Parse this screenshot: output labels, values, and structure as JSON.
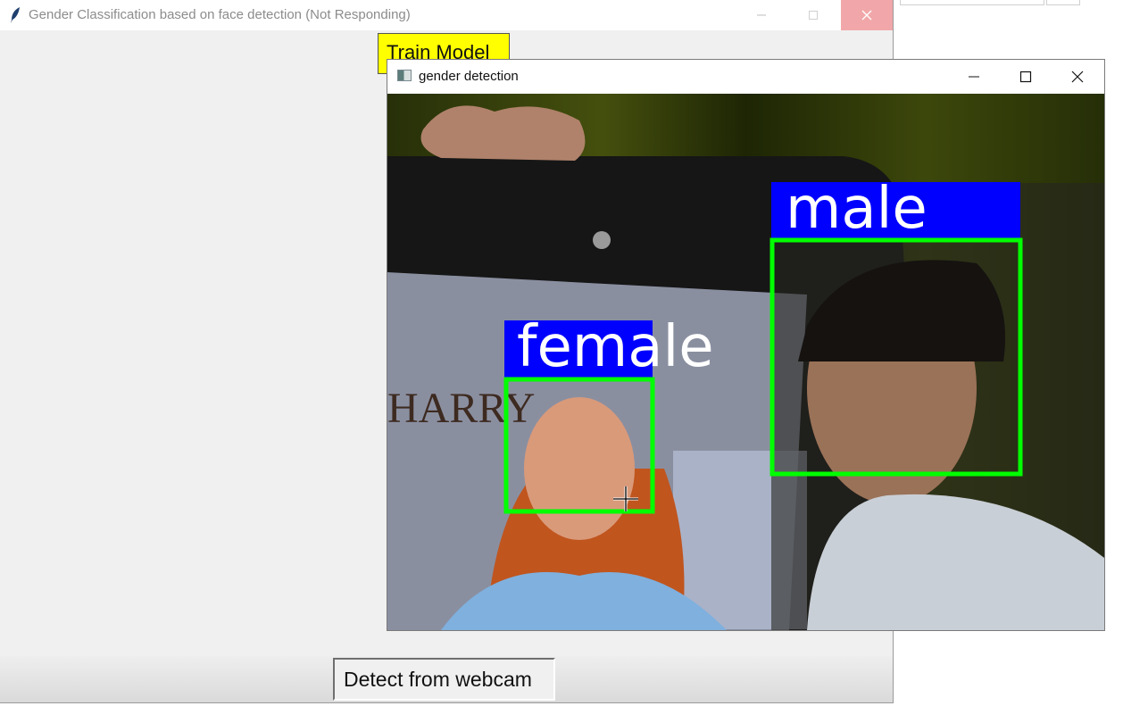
{
  "main_window": {
    "title": "Gender Classification based on face detection (Not Responding)",
    "train_button": "Train Model",
    "detect_button": "Detect from webcam"
  },
  "cv_window": {
    "title": "gender detection",
    "labels": [
      "male",
      "female"
    ]
  },
  "colors": {
    "label_bg": "#0000ff",
    "box": "#00ff00",
    "train_button_bg": "#ffff00",
    "close_hover": "#f1a7a9"
  },
  "icons": [
    "feather-icon",
    "minimize-icon",
    "maximize-icon",
    "close-icon",
    "opencv-window-icon",
    "crosshair-cursor-icon"
  ]
}
